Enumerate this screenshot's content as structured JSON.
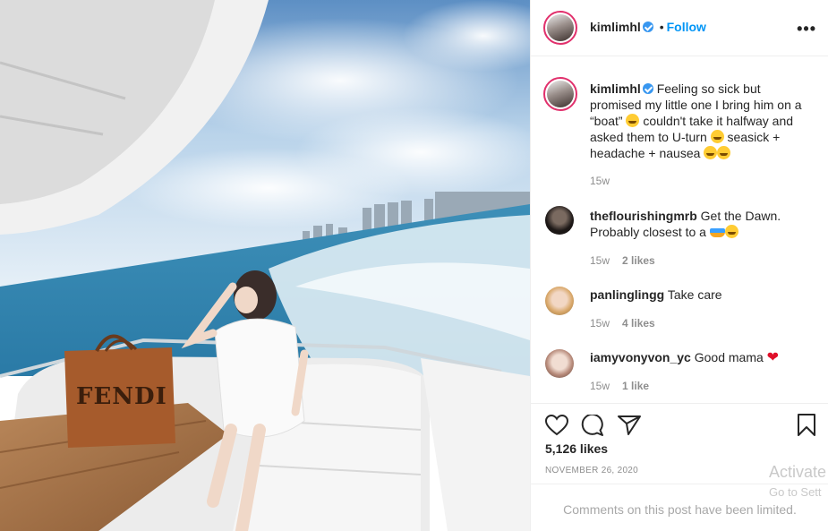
{
  "post": {
    "author": "kimlimhl",
    "follow_label": "Follow",
    "separator": "•",
    "more_label": "•••",
    "caption": "Feeling so sick but promised my little one I bring him on a “boat”",
    "caption_2": "couldn't take it halfway and asked them to U-turn",
    "caption_3": "seasick + headache + nausea",
    "caption_age": "15w",
    "likes": "5,126 likes",
    "date": "NOVEMBER 26, 2020",
    "comments_limited": "Comments on this post have been limited.",
    "bag_brand": "FENDI"
  },
  "comments": [
    {
      "user": "theflourishingmrb",
      "text": "Get the Dawn. Probably closest to a",
      "age": "15w",
      "likes": "2 likes"
    },
    {
      "user": "panlinglingg",
      "text": "Take care",
      "age": "15w",
      "likes": "4 likes"
    },
    {
      "user": "iamyvonyvon_yc",
      "text": "Good mama",
      "age": "15w",
      "likes": "1 like"
    }
  ],
  "watermark": {
    "line1": "Activate",
    "line2": "Go to Sett"
  },
  "icons": [
    "heart-icon",
    "comment-icon",
    "share-icon",
    "bookmark-icon",
    "verified-badge-icon",
    "more-options-icon"
  ],
  "colors": {
    "follow_blue": "#0095f6",
    "verified_blue": "#3897f0",
    "heart_red": "#e0102a",
    "muted": "#8e8e8e"
  }
}
